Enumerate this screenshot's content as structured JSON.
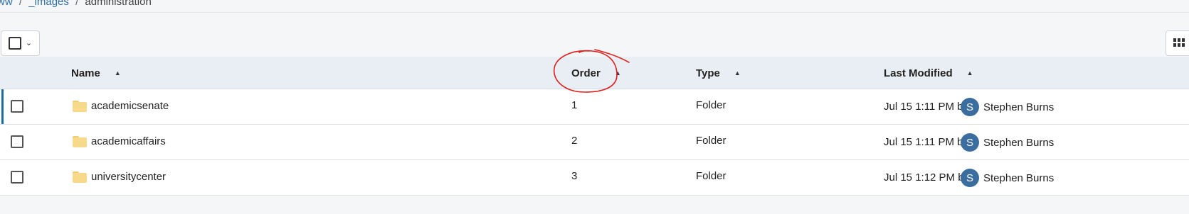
{
  "breadcrumb": {
    "items": [
      {
        "label": "ww",
        "link": true
      },
      {
        "label": "_images",
        "link": true
      },
      {
        "label": "administration",
        "link": false
      }
    ],
    "separator": "/"
  },
  "toolbar": {
    "select_all_icon": "checkbox-icon",
    "chevron_icon": "chevron-down-icon",
    "view_icon": "grid-view-icon"
  },
  "table": {
    "columns": {
      "name": "Name",
      "order": "Order",
      "type": "Type",
      "last_modified": "Last Modified"
    },
    "sort_icon": "sort-asc-icon",
    "rows": [
      {
        "name": "academicsenate",
        "order": "1",
        "type": "Folder",
        "modified": "Jul 15 1:11 PM by",
        "avatar": "S",
        "user": "Stephen Burns"
      },
      {
        "name": "academicaffairs",
        "order": "2",
        "type": "Folder",
        "modified": "Jul 15 1:11 PM by",
        "avatar": "S",
        "user": "Stephen Burns"
      },
      {
        "name": "universitycenter",
        "order": "3",
        "type": "Folder",
        "modified": "Jul 15 1:12 PM by",
        "avatar": "S",
        "user": "Stephen Burns"
      }
    ]
  },
  "colors": {
    "header_bg": "#e9eef4",
    "link": "#2f6fa3",
    "avatar": "#3b6e9e",
    "active_row_bar": "#1a6fa0",
    "annotation": "#e0201e"
  }
}
